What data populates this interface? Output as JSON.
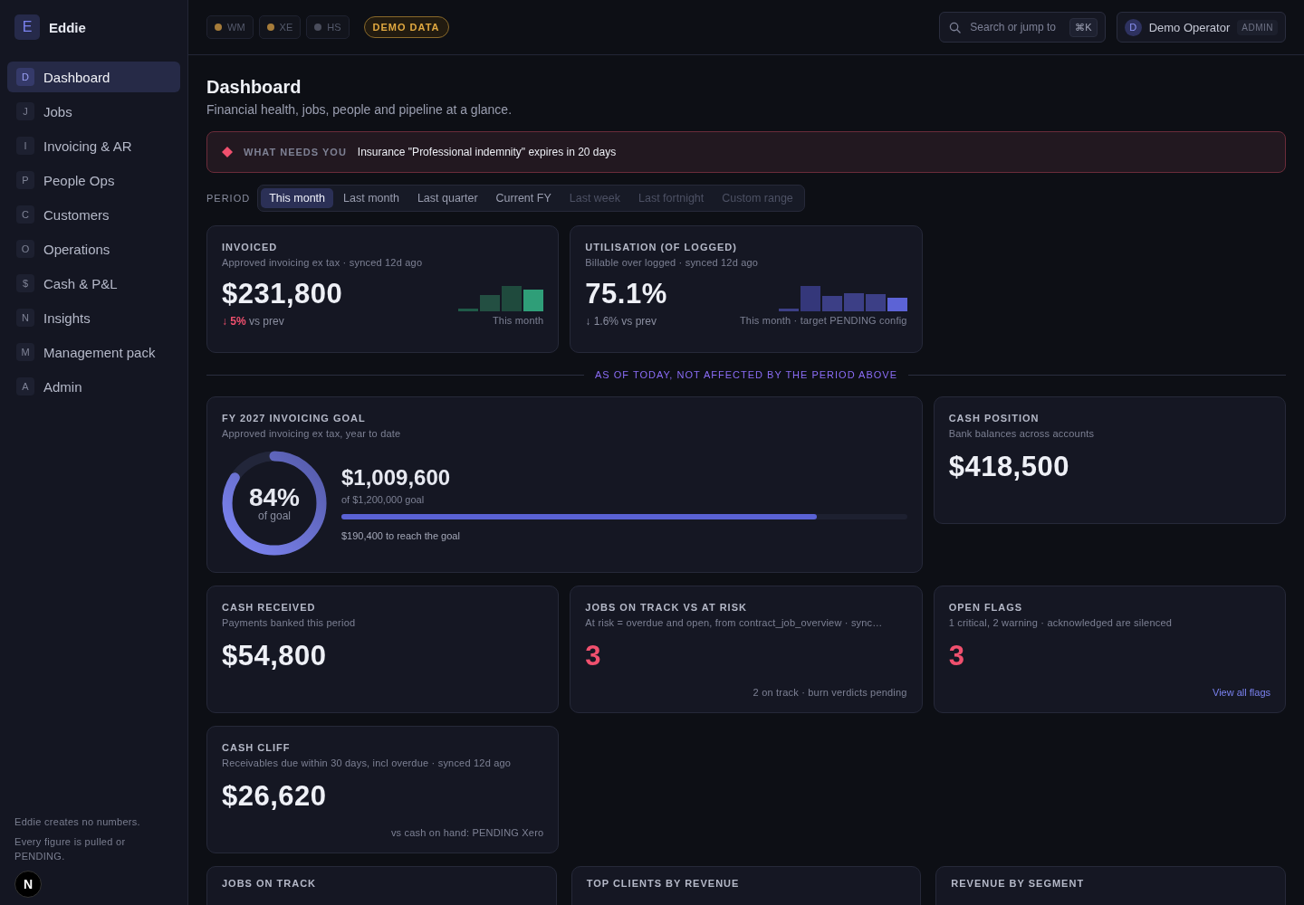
{
  "brand": {
    "initial": "E",
    "name": "Eddie"
  },
  "sidebar": {
    "items": [
      {
        "letter": "D",
        "label": "Dashboard",
        "selected": true
      },
      {
        "letter": "J",
        "label": "Jobs",
        "selected": false
      },
      {
        "letter": "I",
        "label": "Invoicing & AR",
        "selected": false
      },
      {
        "letter": "P",
        "label": "People Ops",
        "selected": false
      },
      {
        "letter": "C",
        "label": "Customers",
        "selected": false
      },
      {
        "letter": "O",
        "label": "Operations",
        "selected": false
      },
      {
        "letter": "$",
        "label": "Cash & P&L",
        "selected": false
      },
      {
        "letter": "N",
        "label": "Insights",
        "selected": false
      },
      {
        "letter": "M",
        "label": "Management pack",
        "selected": false
      },
      {
        "letter": "A",
        "label": "Admin",
        "selected": false
      }
    ],
    "footer": [
      "Eddie creates no numbers.",
      "Every figure is pulled or PENDING."
    ],
    "dev_badge": "N"
  },
  "sources": [
    {
      "label": "WM",
      "color": "#a67c3a"
    },
    {
      "label": "XE",
      "color": "#a67c3a"
    },
    {
      "label": "HS",
      "color": "#4a4d5c"
    }
  ],
  "demo_badge": "DEMO DATA",
  "search": {
    "placeholder": "Search or jump to",
    "shortcut": "⌘K"
  },
  "user": {
    "initial": "D",
    "name": "Demo Operator",
    "role": "ADMIN"
  },
  "page": {
    "title": "Dashboard",
    "subtitle": "Financial health, jobs, people and pipeline at a glance."
  },
  "alert": {
    "label": "WHAT NEEDS YOU",
    "text": "Insurance \"Professional indemnity\" expires in 20 days"
  },
  "period": {
    "label": "PERIOD",
    "options": [
      {
        "label": "This month",
        "selected": true,
        "disabled": false
      },
      {
        "label": "Last month",
        "selected": false,
        "disabled": false
      },
      {
        "label": "Last quarter",
        "selected": false,
        "disabled": false
      },
      {
        "label": "Current FY",
        "selected": false,
        "disabled": false
      },
      {
        "label": "Last week",
        "selected": false,
        "disabled": true
      },
      {
        "label": "Last fortnight",
        "selected": false,
        "disabled": true
      },
      {
        "label": "Custom range",
        "selected": false,
        "disabled": true
      }
    ]
  },
  "kpi_cards": [
    {
      "title": "INVOICED",
      "subtitle": "Approved invoicing ex tax · synced 12d ago",
      "value": "$231,800",
      "delta": {
        "arrow": "↓",
        "amount": "5%",
        "rest": "vs prev",
        "negative": true
      },
      "note": "This month",
      "kind": "revenue"
    },
    {
      "title": "UTILISATION (OF LOGGED)",
      "subtitle": "Billable over logged · synced 12d ago",
      "value": "75.1%",
      "delta": {
        "arrow": "↓",
        "amount": "1.6%",
        "rest": "vs prev",
        "negative": false
      },
      "note": "This month · target PENDING config",
      "kind": "utilisation"
    }
  ],
  "divider_label": "AS OF TODAY, NOT AFFECTED BY THE PERIOD ABOVE",
  "snapshot_cards": [
    {
      "kind": "goal",
      "title": "FY 2027 INVOICING GOAL",
      "subtitle": "Approved invoicing ex tax, year to date",
      "percent": "84%",
      "percent_caption": "of goal",
      "level": 0.84,
      "value": "$1,009,600",
      "target": "of $1,200,000 goal",
      "remaining": "$190,400 to reach the goal"
    },
    {
      "kind": "stat",
      "title": "CASH POSITION",
      "subtitle": "Bank balances across accounts",
      "value": "$418,500",
      "alert": false
    },
    {
      "kind": "stat",
      "title": "CASH RECEIVED",
      "subtitle": "Payments banked this period",
      "value": "$54,800",
      "alert": false
    },
    {
      "kind": "stat",
      "title": "JOBS ON TRACK VS AT RISK",
      "subtitle": "At risk = overdue and open, from contract_job_overview · sync…",
      "value": "3",
      "alert": true,
      "note": "2 on track · burn verdicts pending"
    },
    {
      "kind": "stat",
      "title": "OPEN FLAGS",
      "subtitle": "1 critical, 2 warning · acknowledged are silenced",
      "value": "3",
      "alert": true,
      "link": "View all flags"
    },
    {
      "kind": "stat",
      "title": "CASH CLIFF",
      "subtitle": "Receivables due within 30 days, incl overdue · synced 12d ago",
      "value": "$26,620",
      "alert": false,
      "note": "vs cash on hand: PENDING Xero"
    }
  ],
  "panels": [
    {
      "title": "JOBS ON TRACK"
    },
    {
      "title": "TOP CLIENTS BY REVENUE"
    },
    {
      "title": "REVENUE BY SEGMENT"
    }
  ]
}
